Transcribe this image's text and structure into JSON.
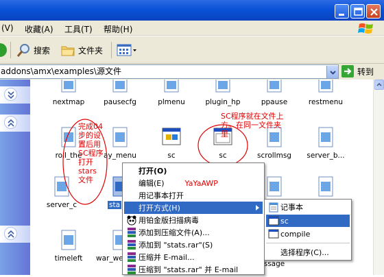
{
  "window": {
    "minimize_label": "",
    "maximize_label": "",
    "close_label": ""
  },
  "menubar": {
    "items": [
      "(V)",
      "收藏(A)",
      "工具(T)",
      "帮助(H)"
    ]
  },
  "toolbar": {
    "search_label": "搜索",
    "folders_label": "文件夹"
  },
  "address": {
    "path": "addons\\amx\\examples\\源文件",
    "go_label": "转到"
  },
  "files": [
    {
      "name": "nextmap"
    },
    {
      "name": "pausecfg"
    },
    {
      "name": "plmenu"
    },
    {
      "name": "plugin_hp"
    },
    {
      "name": "ppause"
    },
    {
      "name": "restmenu"
    },
    {
      "name": "roll_the"
    },
    {
      "name": "ay_menu"
    },
    {
      "name": "sc"
    },
    {
      "name": "sc"
    },
    {
      "name": "scrollmsg"
    },
    {
      "name": "server_b..."
    },
    {
      "name": "server_c"
    },
    {
      "name": "sta"
    },
    {
      "name": "timeleft"
    },
    {
      "name": "war_we"
    },
    {
      "name": "ssage"
    }
  ],
  "annotations": {
    "left_note": [
      "完成04",
      "步的设",
      "置后用",
      "SC程序",
      "打开",
      "stars",
      "文件"
    ],
    "right_note": [
      "SC程序就在文件上",
      "方。在同一文件夹",
      "里"
    ],
    "menu_note": "YaYaAWP"
  },
  "context_menu": {
    "items": [
      {
        "label": "打开(O)"
      },
      {
        "label": "编辑(E)"
      },
      {
        "label": "用记事本打开"
      },
      {
        "label": "打开方式(H)"
      },
      {
        "label": "用铂金版扫描病毒"
      },
      {
        "label": "添加到压缩文件(A)..."
      },
      {
        "label": "添加到 \"stats.rar\"(S)"
      },
      {
        "label": "压缩并 E-mail..."
      },
      {
        "label": "压缩到 \"stats.rar\" 并 E-mail"
      }
    ]
  },
  "submenu": {
    "items": [
      {
        "label": "记事本"
      },
      {
        "label": "sc"
      },
      {
        "label": "compile"
      },
      {
        "label": "选择程序(C)..."
      }
    ]
  },
  "colors": {
    "title_bar": "#0a52d7",
    "highlight": "#316ac5",
    "annotation": "#e00000"
  }
}
